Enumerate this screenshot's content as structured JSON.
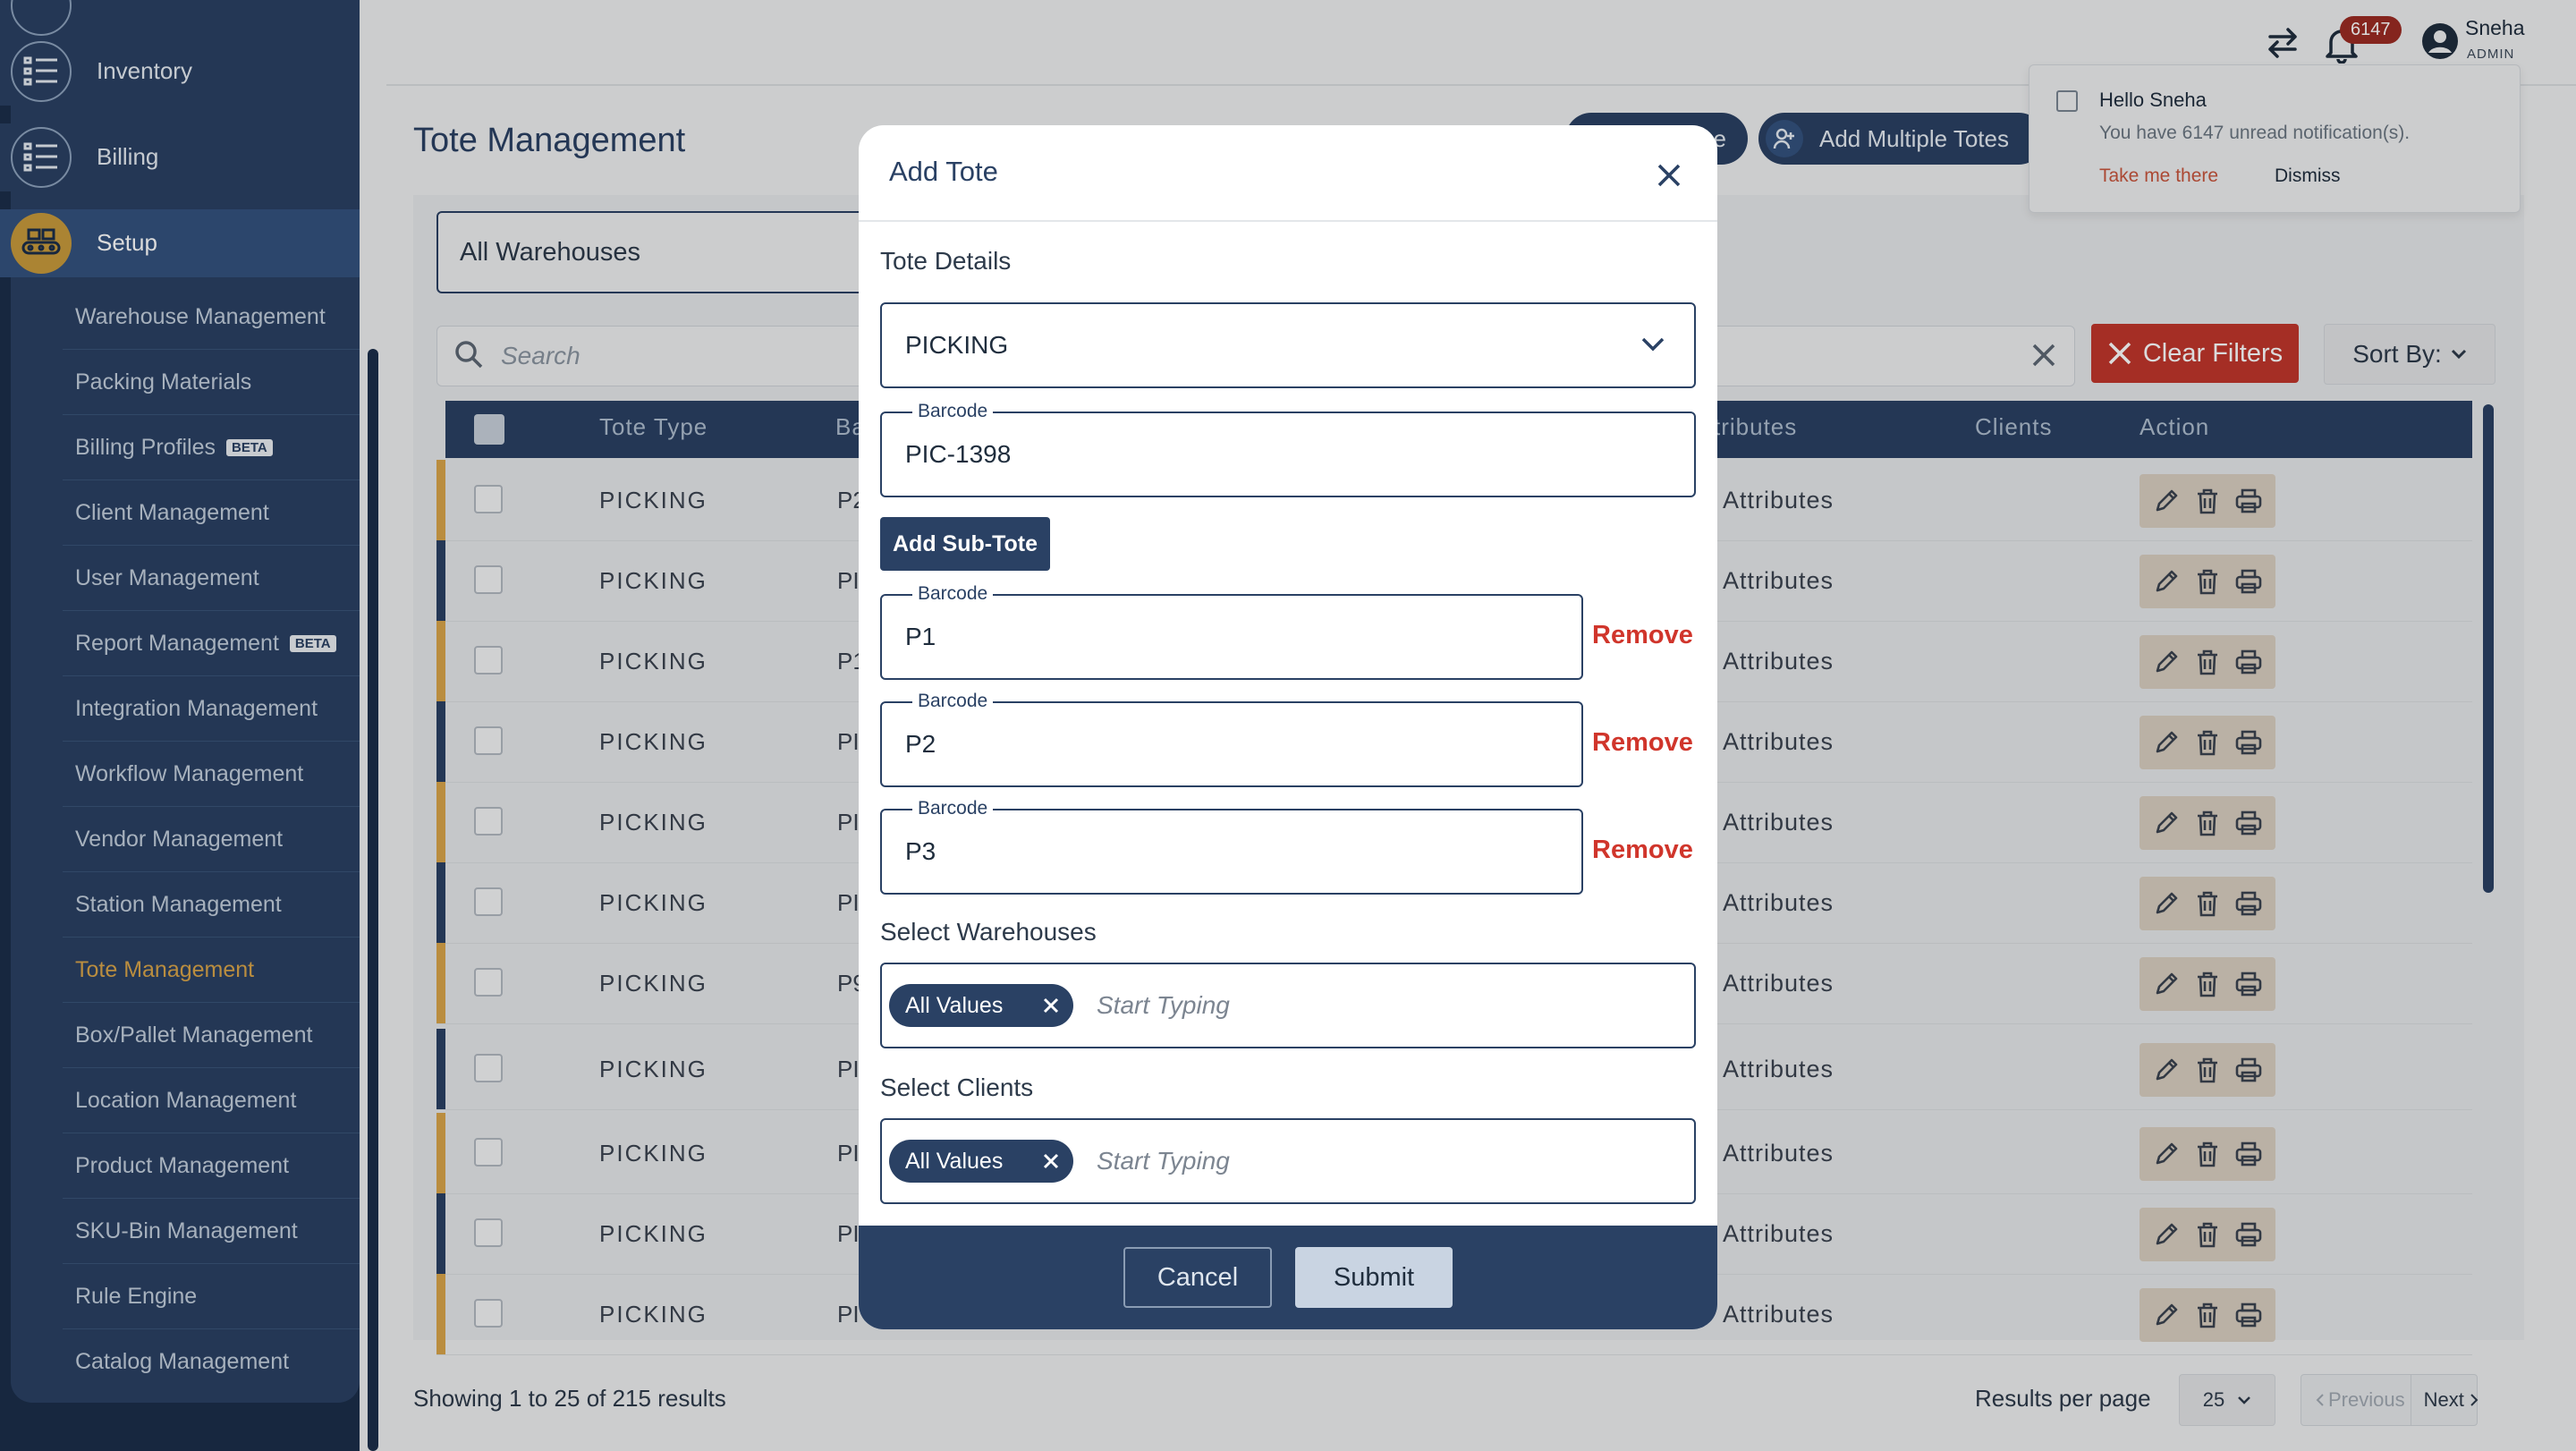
{
  "sidebar": {
    "top_items": [
      {
        "label": "Inventory",
        "icon": "list-icon"
      },
      {
        "label": "Billing",
        "icon": "list-icon"
      }
    ],
    "setup": {
      "label": "Setup",
      "icon": "conveyor-icon"
    },
    "sub_items": [
      {
        "label": "Warehouse Management"
      },
      {
        "label": "Packing Materials"
      },
      {
        "label": "Billing Profiles",
        "badge": "BETA"
      },
      {
        "label": "Client Management"
      },
      {
        "label": "User Management"
      },
      {
        "label": "Report Management",
        "badge": "BETA"
      },
      {
        "label": "Integration Management"
      },
      {
        "label": "Workflow Management"
      },
      {
        "label": "Vendor Management"
      },
      {
        "label": "Station Management"
      },
      {
        "label": "Tote Management",
        "active": true
      },
      {
        "label": "Box/Pallet Management"
      },
      {
        "label": "Location Management"
      },
      {
        "label": "Product Management"
      },
      {
        "label": "SKU-Bin Management"
      },
      {
        "label": "Rule Engine"
      },
      {
        "label": "Catalog Management"
      }
    ]
  },
  "topbar": {
    "notification_count": "6147",
    "user_name": "Sneha",
    "user_role": "ADMIN"
  },
  "notification": {
    "title": "Hello Sneha",
    "message": "You have 6147 unread notification(s).",
    "action": "Take me there",
    "dismiss": "Dismiss"
  },
  "page": {
    "title": "Tote Management",
    "add_tote_partial": "e",
    "add_multiple_label": "Add Multiple Totes",
    "warehouse_filter": "All Warehouses",
    "search_placeholder": "Search",
    "clear_filters": "Clear Filters",
    "sort_by": "Sort By:"
  },
  "table": {
    "headers": {
      "type": "Tote Type",
      "barcode": "Ba",
      "attributes": "tributes",
      "clients": "Clients",
      "action": "Action"
    },
    "rows": [
      {
        "type": "PICKING",
        "barcode": "P2",
        "attributes": "Attributes",
        "accent": "#d9a54a"
      },
      {
        "type": "PICKING",
        "barcode": "PI",
        "attributes": "Attributes",
        "accent": "#2a4164"
      },
      {
        "type": "PICKING",
        "barcode": "P1",
        "attributes": "Attributes",
        "accent": "#d9a54a"
      },
      {
        "type": "PICKING",
        "barcode": "PI",
        "attributes": "Attributes",
        "accent": "#2a4164"
      },
      {
        "type": "PICKING",
        "barcode": "PI",
        "attributes": "Attributes",
        "accent": "#d9a54a"
      },
      {
        "type": "PICKING",
        "barcode": "PI",
        "attributes": "Attributes",
        "accent": "#2a4164"
      },
      {
        "type": "PICKING",
        "barcode": "P9",
        "attributes": "Attributes",
        "accent": "#d9a54a"
      },
      {
        "type": "PICKING",
        "barcode": "PI",
        "attributes": "Attributes",
        "accent": "#2a4164"
      },
      {
        "type": "PICKING",
        "barcode": "PI",
        "attributes": "Attributes",
        "accent": "#d9a54a"
      },
      {
        "type": "PICKING",
        "barcode": "PI",
        "attributes": "Attributes",
        "accent": "#2a4164"
      },
      {
        "type": "PICKING",
        "barcode": "PI",
        "attributes": "Attributes",
        "accent": "#d9a54a"
      }
    ]
  },
  "footer": {
    "showing": "Showing 1 to 25 of 215 results",
    "rpp_label": "Results per page",
    "rpp_value": "25",
    "previous": "Previous",
    "next": "Next"
  },
  "modal": {
    "title": "Add Tote",
    "section_details": "Tote Details",
    "tote_type": "PICKING",
    "barcode_legend": "Barcode",
    "barcode_value": "PIC-1398",
    "add_sub_tote": "Add Sub-Tote",
    "sub_totes": [
      {
        "legend": "Barcode",
        "value": "P1",
        "remove": "Remove"
      },
      {
        "legend": "Barcode",
        "value": "P2",
        "remove": "Remove"
      },
      {
        "legend": "Barcode",
        "value": "P3",
        "remove": "Remove"
      }
    ],
    "warehouses_label": "Select Warehouses",
    "warehouses_chip": "All Values",
    "warehouses_placeholder": "Start Typing",
    "clients_label": "Select Clients",
    "clients_chip": "All Values",
    "clients_placeholder": "Start Typing",
    "cancel": "Cancel",
    "submit": "Submit"
  }
}
